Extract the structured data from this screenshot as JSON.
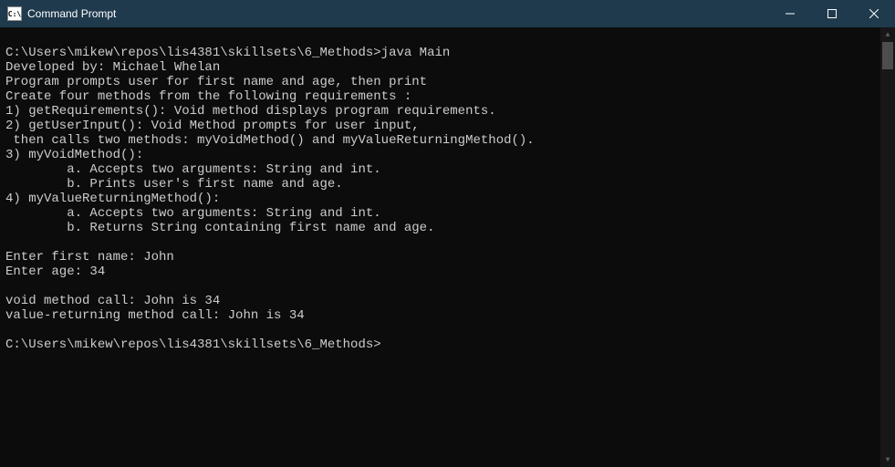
{
  "window": {
    "title": "Command Prompt",
    "icon_text": "C:\\"
  },
  "terminal": {
    "lines": [
      "",
      "C:\\Users\\mikew\\repos\\lis4381\\skillsets\\6_Methods>java Main",
      "Developed by: Michael Whelan",
      "Program prompts user for first name and age, then print",
      "Create four methods from the following requirements :",
      "1) getRequirements(): Void method displays program requirements.",
      "2) getUserInput(): Void Method prompts for user input,",
      " then calls two methods: myVoidMethod() and myValueReturningMethod().",
      "3) myVoidMethod():",
      "        a. Accepts two arguments: String and int.",
      "        b. Prints user's first name and age.",
      "4) myValueReturningMethod():",
      "        a. Accepts two arguments: String and int.",
      "        b. Returns String containing first name and age.",
      "",
      "Enter first name: John",
      "Enter age: 34",
      "",
      "void method call: John is 34",
      "value-returning method call: John is 34",
      "",
      "C:\\Users\\mikew\\repos\\lis4381\\skillsets\\6_Methods>"
    ]
  }
}
